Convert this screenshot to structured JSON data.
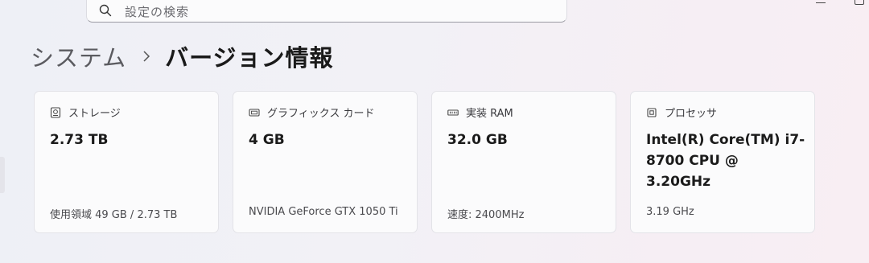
{
  "search": {
    "placeholder": "設定の検索"
  },
  "breadcrumb": {
    "parent": "システム",
    "current": "バージョン情報"
  },
  "cards": [
    {
      "icon": "storage-icon",
      "label": "ストレージ",
      "value": "2.73 TB",
      "detail": "使用領域 49 GB / 2.73 TB"
    },
    {
      "icon": "graphics-card-icon",
      "label": "グラフィックス カード",
      "value": "4 GB",
      "detail": "NVIDIA GeForce GTX 1050 Ti"
    },
    {
      "icon": "ram-icon",
      "label": "実装 RAM",
      "value": "32.0 GB",
      "detail": "速度: 2400MHz"
    },
    {
      "icon": "processor-icon",
      "label": "プロセッサ",
      "value": "Intel(R) Core(TM) i7-8700 CPU @ 3.20GHz",
      "detail": "3.19 GHz"
    }
  ]
}
